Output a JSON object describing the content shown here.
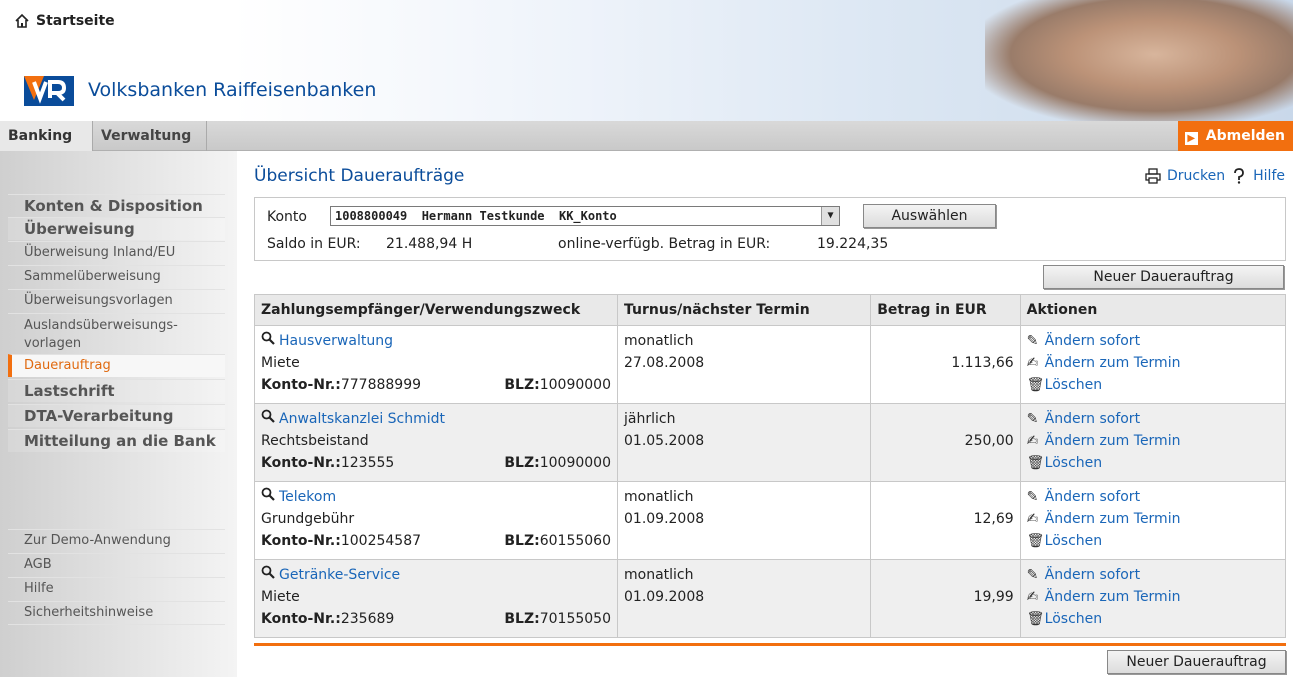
{
  "header": {
    "home_label": "Startseite",
    "brand": "Volksbanken Raiffeisenbanken",
    "colors": {
      "brand_blue": "#0a4c9a",
      "accent_orange": "#f26f0f"
    }
  },
  "tabs": [
    {
      "label": "Banking",
      "active": true
    },
    {
      "label": "Verwaltung",
      "active": false
    }
  ],
  "logout_label": "Abmelden",
  "sidebar": {
    "items": [
      {
        "label": "Konten & Disposition",
        "style": "bold"
      },
      {
        "label": "Überweisung",
        "style": "bold"
      },
      {
        "label": "Überweisung Inland/EU",
        "style": "normal"
      },
      {
        "label": "Sammelüberweisung",
        "style": "normal"
      },
      {
        "label": "Überweisungsvorlagen",
        "style": "normal"
      },
      {
        "label": "Auslandsüberweisungs-vorlagen",
        "style": "normal"
      },
      {
        "label": "Dauerauftrag",
        "style": "active"
      },
      {
        "label": "Lastschrift",
        "style": "bold"
      },
      {
        "label": "DTA-Verarbeitung",
        "style": "bold"
      },
      {
        "label": "Mitteilung an die Bank",
        "style": "bold"
      }
    ],
    "footer_items": [
      {
        "label": "Zur Demo-Anwendung"
      },
      {
        "label": "AGB"
      },
      {
        "label": "Hilfe"
      },
      {
        "label": "Sicherheitshinweise"
      }
    ]
  },
  "main": {
    "title": "Übersicht Daueraufträge",
    "print_label": "Drucken",
    "help_label": "Hilfe",
    "account": {
      "konto_label": "Konto",
      "selected": "1008800049  Hermann Testkunde  KK_Konto",
      "select_button": "Auswählen",
      "saldo_label": "Saldo in EUR:",
      "saldo_value": "21.488,94 H",
      "available_label": "online-verfügb. Betrag in EUR:",
      "available_value": "19.224,35"
    },
    "new_order_button": "Neuer Dauerauftrag",
    "columns": [
      "Zahlungsempfänger/Verwendungszweck",
      "Turnus/nächster Termin",
      "Betrag in EUR",
      "Aktionen"
    ],
    "konto_nr_label": "Konto-Nr.:",
    "blz_label": "BLZ:",
    "actions": {
      "change_now": "Ändern sofort",
      "change_scheduled": "Ändern zum Termin",
      "delete": "Löschen"
    },
    "rows": [
      {
        "payee": "Hausverwaltung",
        "purpose": "Miete",
        "konto": "777888999",
        "blz": "10090000",
        "turnus": "monatlich",
        "termin": "27.08.2008",
        "betrag": "1.113,66"
      },
      {
        "payee": "Anwaltskanzlei Schmidt",
        "purpose": "Rechtsbeistand",
        "konto": "123555",
        "blz": "10090000",
        "turnus": "jährlich",
        "termin": "01.05.2008",
        "betrag": "250,00"
      },
      {
        "payee": "Telekom",
        "purpose": "Grundgebühr",
        "konto": "100254587",
        "blz": "60155060",
        "turnus": "monatlich",
        "termin": "01.09.2008",
        "betrag": "12,69"
      },
      {
        "payee": "Getränke-Service",
        "purpose": "Miete",
        "konto": "235689",
        "blz": "70155050",
        "turnus": "monatlich",
        "termin": "01.09.2008",
        "betrag": "19,99"
      }
    ]
  }
}
